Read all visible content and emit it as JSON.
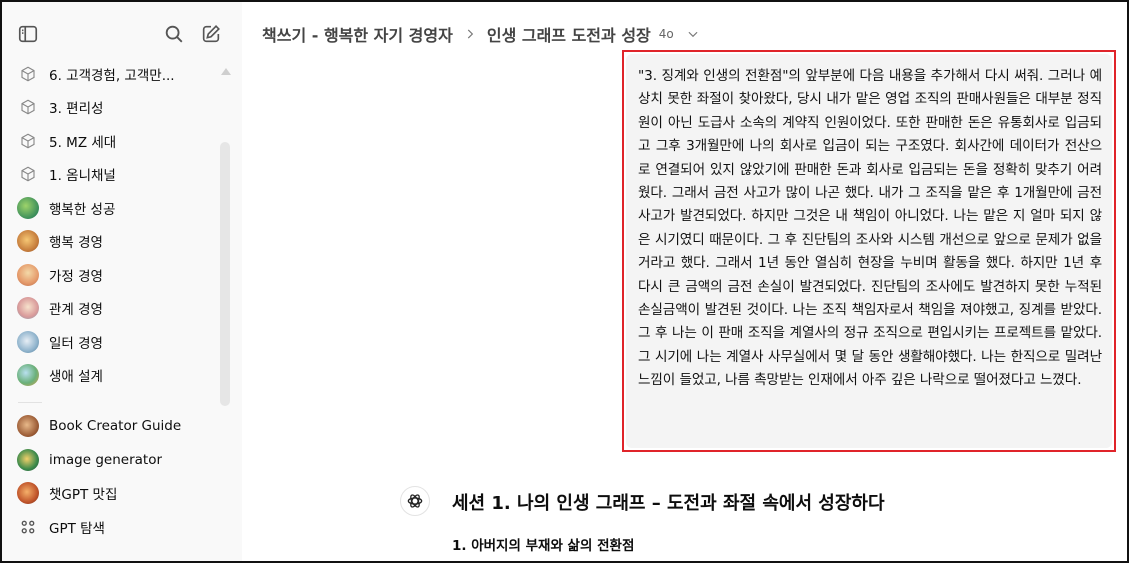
{
  "sidebar": {
    "items": [
      {
        "label": "6. 고객경험, 고객만...",
        "avatar": "cube-icon"
      },
      {
        "label": "3. 편리성",
        "avatar": "cube-icon"
      },
      {
        "label": "5. MZ 세대",
        "avatar": "cube-icon"
      },
      {
        "label": "1. 옴니채널",
        "avatar": "cube-icon"
      },
      {
        "label": "행복한 성공",
        "avatar": "gpt-avatar"
      },
      {
        "label": "행복 경영",
        "avatar": "gpt-avatar"
      },
      {
        "label": "가정 경영",
        "avatar": "gpt-avatar"
      },
      {
        "label": "관계 경영",
        "avatar": "gpt-avatar"
      },
      {
        "label": "일터 경영",
        "avatar": "gpt-avatar"
      },
      {
        "label": "생애 설계",
        "avatar": "gpt-avatar"
      }
    ],
    "gpts": [
      {
        "label": "Book Creator Guide"
      },
      {
        "label": "image generator"
      },
      {
        "label": "챗GPT 맛집"
      },
      {
        "label": "GPT 탐색"
      }
    ]
  },
  "header": {
    "project": "책쓰기 - 행복한 자기 경영자",
    "chat": "인생 그래프 도전과 성장",
    "model": "4o"
  },
  "user_message": "\"3. 징계와 인생의 전환점\"의 앞부분에 다음 내용을 추가해서 다시 써줘. 그러나 예상치 못한 좌절이 찾아왔다, 당시 내가 맡은 영업 조직의 판매사원들은 대부분 정직원이 아닌 도급사 소속의 계약직 인원이었다. 또한 판매한 돈은 유통회사로 입금되고 그후 3개월만에 나의 회사로 입금이 되는 구조였다. 회사간에 데이터가 전산으로 연결되어 있지 않았기에 판매한 돈과 회사로 입금되는 돈을 정확히 맞추기 어려웠다. 그래서 금전 사고가 많이 나곤 했다. 내가 그 조직을 맡은 후 1개월만에 금전 사고가 발견되었다. 하지만 그것은 내 책임이 아니었다. 나는 맡은 지 얼마 되지 않은 시기였디 때문이다. 그 후 진단팀의 조사와 시스템 개선으로 앞으로 문제가 없을 거라고 했다. 그래서 1년 동안 열심히 현장을 누비며 활동을 했다. 하지만 1년 후 다시 큰 금액의 금전 손실이 발견되었다. 진단팀의 조사에도 발견하지 못한 누적된 손실금액이 발견된 것이다. 나는 조직 책임자로서 책임을 져야했고, 징계를 받았다. 그 후 나는 이 판매 조직을 계열사의 정규 조직으로 편입시키는 프로젝트를 맡았다. 그 시기에 나는 계열사 사무실에서 몇 달 동안 생활해야했다. 나는 한직으로 밀려난 느낌이 들었고, 나름 촉망받는 인재에서 아주 깊은 나락으로 떨어졌다고 느꼈다.",
  "assistant": {
    "title": "세션 1. 나의 인생 그래프 – 도전과 좌절 속에서 성장하다",
    "subtitle": "1. 아버지의 부재와 삶의 전환점"
  },
  "colors": {
    "highlight_border": "#e0242a",
    "sidebar_bg": "#f9f9f9",
    "bubble_bg": "#f4f4f4"
  }
}
